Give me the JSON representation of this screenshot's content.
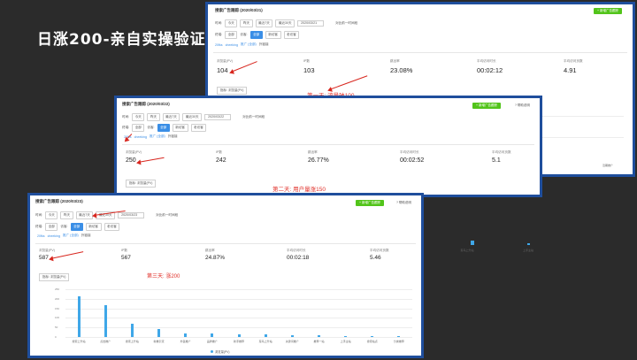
{
  "headline": "日涨200-亲自实操验证",
  "common": {
    "time_label": "时间:",
    "time_options": [
      "今天",
      "昨天",
      "最近7天",
      "最近30天"
    ],
    "compare_label": "对比前一时间段",
    "terminal_label": "终端:",
    "terminal_value": "全部",
    "visitor_label": "访客:",
    "visitor_options": [
      "全部",
      "新访客",
      "老访客"
    ],
    "add_button": "+ 新增广告跟踪",
    "help_label": "帮助说明",
    "stat_labels": [
      "浏览量(PV)",
      "IP数",
      "跳出率",
      "平均访问时长",
      "平均访问页数"
    ],
    "metric_select": "指标: 浏览量(PV)",
    "filter_crumb_items": [
      "20fks",
      "cheeking",
      "推广 (全部)",
      "外链接"
    ]
  },
  "panels": [
    {
      "title": "搜索广告跟踪 (2020/03/21)",
      "date_value": "2020/03/21",
      "stats": [
        "104",
        "103",
        "23.08%",
        "00:02:12",
        "4.91"
      ],
      "annotation": "第一天: 流量破100",
      "category_label": "近期推广"
    },
    {
      "title": "搜索广告跟踪 (2020/03/22)",
      "date_value": "2020/03/22",
      "stats": [
        "250",
        "242",
        "26.77%",
        "00:02:52",
        "5.1"
      ],
      "annotation": "第二天: 用户量涨150"
    },
    {
      "title": "搜索广告跟踪 (2020/03/23)",
      "date_value": "2020/03/23",
      "stats": [
        "587",
        "567",
        "24.87%",
        "00:02:18",
        "5.46"
      ],
      "annotation": "第三天: 涨200"
    }
  ],
  "side_labels": [
    "菜鸟上升站",
    "上手主站"
  ],
  "chart_data": {
    "type": "bar",
    "title": "",
    "categories": [
      "搜索上升站",
      "点击推广",
      "搜索上升站",
      "新推引流",
      "外链推广",
      "品牌推广",
      "新手推荐",
      "菜鸟上升站",
      "关键词推广",
      "推荐一站",
      "上手主站",
      "搜索站点",
      "分类推荐"
    ],
    "series": [
      {
        "name": "浏览量(PV)",
        "values": [
          215,
          165,
          70,
          40,
          20,
          18,
          16,
          12,
          10,
          8,
          6,
          5,
          4
        ]
      }
    ],
    "ylim": [
      0,
      250
    ],
    "yticks": [
      0,
      50,
      100,
      150,
      200,
      250
    ],
    "legend": "bottom",
    "grid": true,
    "color": "#3fa7e8"
  }
}
